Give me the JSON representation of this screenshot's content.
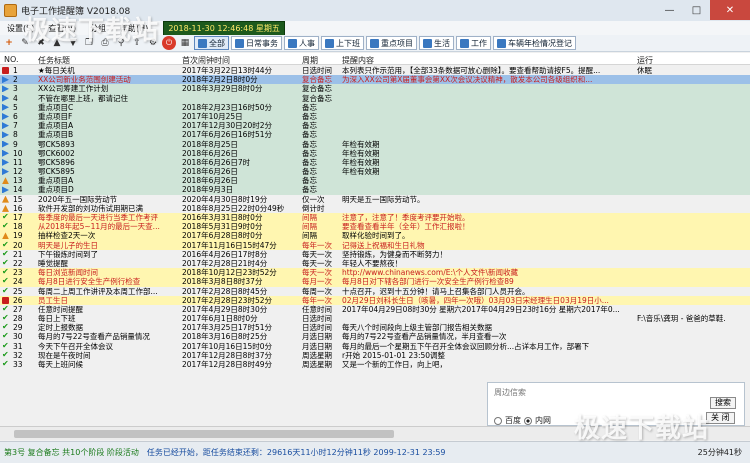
{
  "window": {
    "title": "电子工作提醒簿 V2018.08"
  },
  "menu": [
    "设置(S)",
    "查看(V)",
    "分组",
    "帮助(H)"
  ],
  "datetime": "2018-11-30 12:46:48 星期五",
  "toolbar": {
    "stop_icon": "⏻",
    "add": "+",
    "cats": [
      "全部",
      "日常事务",
      "人事",
      "上下班",
      "重点项目",
      "生活",
      "工作",
      "车辆年检情况登记"
    ]
  },
  "columns": {
    "no": "NO.",
    "title": "任务标题",
    "first": "首次闹钟时间",
    "cycle": "周期",
    "content": "提醒内容",
    "run": "运行"
  },
  "rows": [
    {
      "no": "1",
      "icon": "red",
      "title": "★每日关机",
      "first": "2017年3月22日13时44分",
      "cycle": "日选时间",
      "content": "本列表只作示范用，【全部33条数据可放心删除】。要查看帮助请按F5。提醒...",
      "run": "休眠",
      "bg": "white"
    },
    {
      "no": "2",
      "icon": "blue",
      "title": "XX公司新业务范围创建活动",
      "first": "2018年2月2日8时0分",
      "cycle": "复合备忘",
      "content": "为深入XX公司第X届董事会第XX次会议决议精神，散发本公司各级组织和...",
      "run": "",
      "bg": "blue",
      "red": true
    },
    {
      "no": "3",
      "icon": "blue",
      "title": "XX公司筹建工作计划",
      "first": "2018年3月29日8时0分",
      "cycle": "复合备忘",
      "content": "",
      "run": "",
      "bg": "green"
    },
    {
      "no": "4",
      "icon": "blue",
      "title": "不管在哪里上班，都请记住",
      "first": "",
      "cycle": "复合备忘",
      "content": "",
      "run": "",
      "bg": "green"
    },
    {
      "no": "5",
      "icon": "blue",
      "title": "重点项目C",
      "first": "2018年2月23日16时50分",
      "cycle": "备忘",
      "content": "",
      "run": "",
      "bg": "green"
    },
    {
      "no": "6",
      "icon": "blue",
      "title": "重点项目F",
      "first": "2017年10月25日",
      "cycle": "备忘",
      "content": "",
      "run": "",
      "bg": "green"
    },
    {
      "no": "7",
      "icon": "blue",
      "title": "重点项目A",
      "first": "2017年12月30日20时2分",
      "cycle": "备忘",
      "content": "",
      "run": "",
      "bg": "green"
    },
    {
      "no": "8",
      "icon": "blue",
      "title": "重点项目B",
      "first": "2017年6月26日16时51分",
      "cycle": "备忘",
      "content": "",
      "run": "",
      "bg": "green"
    },
    {
      "no": "9",
      "icon": "blue",
      "title": "鄂CK5893",
      "first": "2018年8月25日",
      "cycle": "备忘",
      "content": "年检有效期",
      "run": "",
      "bg": "green"
    },
    {
      "no": "10",
      "icon": "blue",
      "title": "鄂CK6002",
      "first": "2018年6月26日",
      "cycle": "备忘",
      "content": "年检有效期",
      "run": "",
      "bg": "green"
    },
    {
      "no": "11",
      "icon": "blue",
      "title": "鄂CK5896",
      "first": "2018年6月26日7时",
      "cycle": "备忘",
      "content": "年检有效期",
      "run": "",
      "bg": "green"
    },
    {
      "no": "12",
      "icon": "blue",
      "title": "鄂CK5895",
      "first": "2018年6月26日",
      "cycle": "备忘",
      "content": "年检有效期",
      "run": "",
      "bg": "green"
    },
    {
      "no": "13",
      "icon": "orange",
      "title": "重点项目A",
      "first": "2018年6月26日",
      "cycle": "备忘",
      "content": "",
      "run": "",
      "bg": "green"
    },
    {
      "no": "14",
      "icon": "blue",
      "title": "重点项目D",
      "first": "2018年9月3日",
      "cycle": "备忘",
      "content": "",
      "run": "",
      "bg": "green"
    },
    {
      "no": "15",
      "icon": "orange",
      "title": "2020年五一国际劳动节",
      "first": "2020年4月30日8时19分",
      "cycle": "仅一次",
      "content": "明天是五一国际劳动节。",
      "run": "",
      "bg": "white"
    },
    {
      "no": "16",
      "icon": "orange",
      "title": "软件开发部的刘功伟试用期已满",
      "first": "2018年8月25日22时0分49秒",
      "cycle": "倒计时",
      "content": "",
      "run": "",
      "bg": "white"
    },
    {
      "no": "17",
      "icon": "check",
      "title": "每季度的最后一天进行当季工作考评",
      "first": "2016年3月31日8时0分",
      "cycle": "间隔",
      "content": "注意了，注意了！季度考评要开始啦。",
      "run": "",
      "bg": "yellow",
      "red": true
    },
    {
      "no": "18",
      "icon": "check",
      "title": "从2018年起5~11月的最后一天查...",
      "first": "2018年5月31日9时0分",
      "cycle": "间隔",
      "content": "要查看查看半年（全年）工作汇报啦！",
      "run": "",
      "bg": "yellow",
      "red": true
    },
    {
      "no": "19",
      "icon": "orange",
      "title": "抽样检查2天一次",
      "first": "2017年6月28日8时0分",
      "cycle": "间隔",
      "content": "取样化验时间到了。",
      "run": "",
      "bg": "yellow"
    },
    {
      "no": "20",
      "icon": "check",
      "title": "明天是儿子的生日",
      "first": "2017年11月16日15时47分",
      "cycle": "每年一次",
      "content": "记得送上祝福和生日礼物",
      "run": "",
      "bg": "yellow",
      "red": true
    },
    {
      "no": "21",
      "icon": "check",
      "title": "下午锻炼时间到了",
      "first": "2016年4月26日17时8分",
      "cycle": "每天一次",
      "content": "坚持锻炼，为健身而不断努力！",
      "run": "",
      "bg": "white"
    },
    {
      "no": "22",
      "icon": "check",
      "title": "睡觉提醒",
      "first": "2017年2月28日21时4分",
      "cycle": "每天一次",
      "content": "年轻人不要熬夜！",
      "run": "",
      "bg": "white"
    },
    {
      "no": "23",
      "icon": "check",
      "title": "每日浏览新闻时间",
      "first": "2018年10月12日23时52分",
      "cycle": "每天一次",
      "content": "http://www.chinanews.com/E:\\个人文件\\新闻收藏",
      "run": "",
      "bg": "yellow",
      "red": true
    },
    {
      "no": "24",
      "icon": "check",
      "title": "每月8日进行安全生产例行检查",
      "first": "2018年3月8日8时37分",
      "cycle": "每月一次",
      "content": "每月8日对下辖各部门进行一次安全生产例行检查89",
      "run": "",
      "bg": "yellow",
      "red": true
    },
    {
      "no": "25",
      "icon": "check",
      "title": "每周二上周工作讲评及本周工作部...",
      "first": "2017年2月28日8时45分",
      "cycle": "每周一次",
      "content": "十点召开，迟到十五分钟！请马上召集各部门人员开会。",
      "run": "",
      "bg": "white"
    },
    {
      "no": "26",
      "icon": "red",
      "title": "员工生日",
      "first": "2017年2月28日23时52分",
      "cycle": "每年一次",
      "content": "02月29日刘科长生日（咳暑，四年一次哦）03月03日宋经理生日03月19日小...",
      "run": "",
      "bg": "yellow",
      "red": true
    },
    {
      "no": "27",
      "icon": "check",
      "title": "任意时间提醒",
      "first": "2017年4月29日8时30分",
      "cycle": "任意时间",
      "content": "2017年04月29日08时30分 星期六2017年04月29日23时16分 星期六2017年0...",
      "run": "",
      "bg": "white"
    },
    {
      "no": "28",
      "icon": "check",
      "title": "每日上下班",
      "first": "2017年6月1日8时0分",
      "cycle": "日选时间",
      "content": "",
      "run": "F:\\音乐\\龚玥 - 爸爸的草鞋.",
      "bg": "white"
    },
    {
      "no": "29",
      "icon": "check",
      "title": "定时上报数据",
      "first": "2017年3月25日17时51分",
      "cycle": "日选时间",
      "content": "每天八个时间段向上级主管部门报告相关数据",
      "run": "",
      "bg": "white"
    },
    {
      "no": "30",
      "icon": "check",
      "title": "每月的7号22号查看产品销量情况",
      "first": "2018年3月16日8时25分",
      "cycle": "月选日期",
      "content": "每月的7号22号查看产品销量情况，半月查看一次",
      "run": "",
      "bg": "white"
    },
    {
      "no": "31",
      "icon": "check",
      "title": "今天下午召开全体会议",
      "first": "2017年10月16日15时0分",
      "cycle": "月选日期",
      "content": "每月的最后一个星期五下午召开全体会议回顾分析...占详本月工作，部署下",
      "run": "",
      "bg": "white"
    },
    {
      "no": "32",
      "icon": "check",
      "title": "现在是午夜时间",
      "first": "2017年12月28日8时37分",
      "cycle": "周选星期",
      "content": "r开始 2015-01-01 23:50调整",
      "run": "",
      "bg": "white"
    },
    {
      "no": "33",
      "icon": "check",
      "title": "每天上班问候",
      "first": "2017年12月28日8时49分",
      "cycle": "周选星期",
      "content": "又是一个新的工作日，向上吧，",
      "run": "",
      "bg": "white"
    }
  ],
  "search_panel": {
    "radio_baidu": "百度",
    "radio_intranet": "内网",
    "search_btn": "搜索",
    "close_btn": "关 闭",
    "peek": "周边信索"
  },
  "status": {
    "s1": "第3号 复合备忘 共10个阶段 阶段活动",
    "s2": "任务已经开始，距任务结束还剩：29616天11小时12分钟11秒 2099-12-31 23:59",
    "s3": "25分钟41秒"
  },
  "watermark": "极速下载站",
  "colors": {
    "accent_blue": "#2f7ad6",
    "row_yellow": "#fff6b0",
    "row_green": "#cfe4d7",
    "status_green": "#1a7a1a"
  }
}
